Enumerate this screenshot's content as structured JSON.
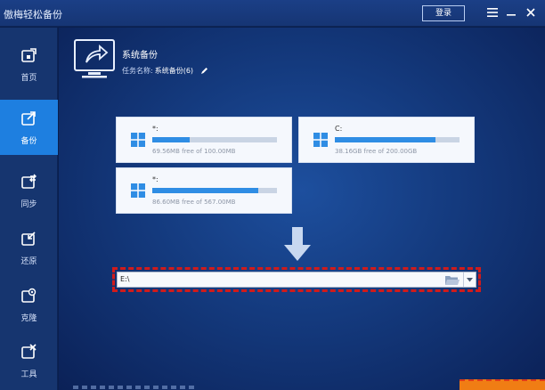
{
  "app": {
    "title": "傲梅轻松备份"
  },
  "titlebar": {
    "login_label": "登录"
  },
  "sidebar": {
    "items": [
      {
        "label": "首页",
        "icon": "home-icon",
        "active": false
      },
      {
        "label": "备份",
        "icon": "backup-icon",
        "active": true
      },
      {
        "label": "同步",
        "icon": "sync-icon",
        "active": false
      },
      {
        "label": "还原",
        "icon": "restore-icon",
        "active": false
      },
      {
        "label": "克隆",
        "icon": "clone-icon",
        "active": false
      },
      {
        "label": "工具",
        "icon": "tools-icon",
        "active": false
      }
    ]
  },
  "task": {
    "title": "系统备份",
    "name_label": "任务名称:",
    "name_value": "系统备份(6)"
  },
  "source_drives": [
    {
      "letter": "*:",
      "size_text": "69.56MB free of 100.00MB",
      "used_fraction": 0.3
    },
    {
      "letter": "C:",
      "size_text": "38.16GB free of 200.00GB",
      "used_fraction": 0.81
    },
    {
      "letter": "*:",
      "size_text": "86.60MB free of 567.00MB",
      "used_fraction": 0.85
    }
  ],
  "destination": {
    "path": "E:\\"
  },
  "colors": {
    "accent": "#1e7fe0",
    "highlight_border": "#d01b1b",
    "start_button": "#f07d14"
  }
}
